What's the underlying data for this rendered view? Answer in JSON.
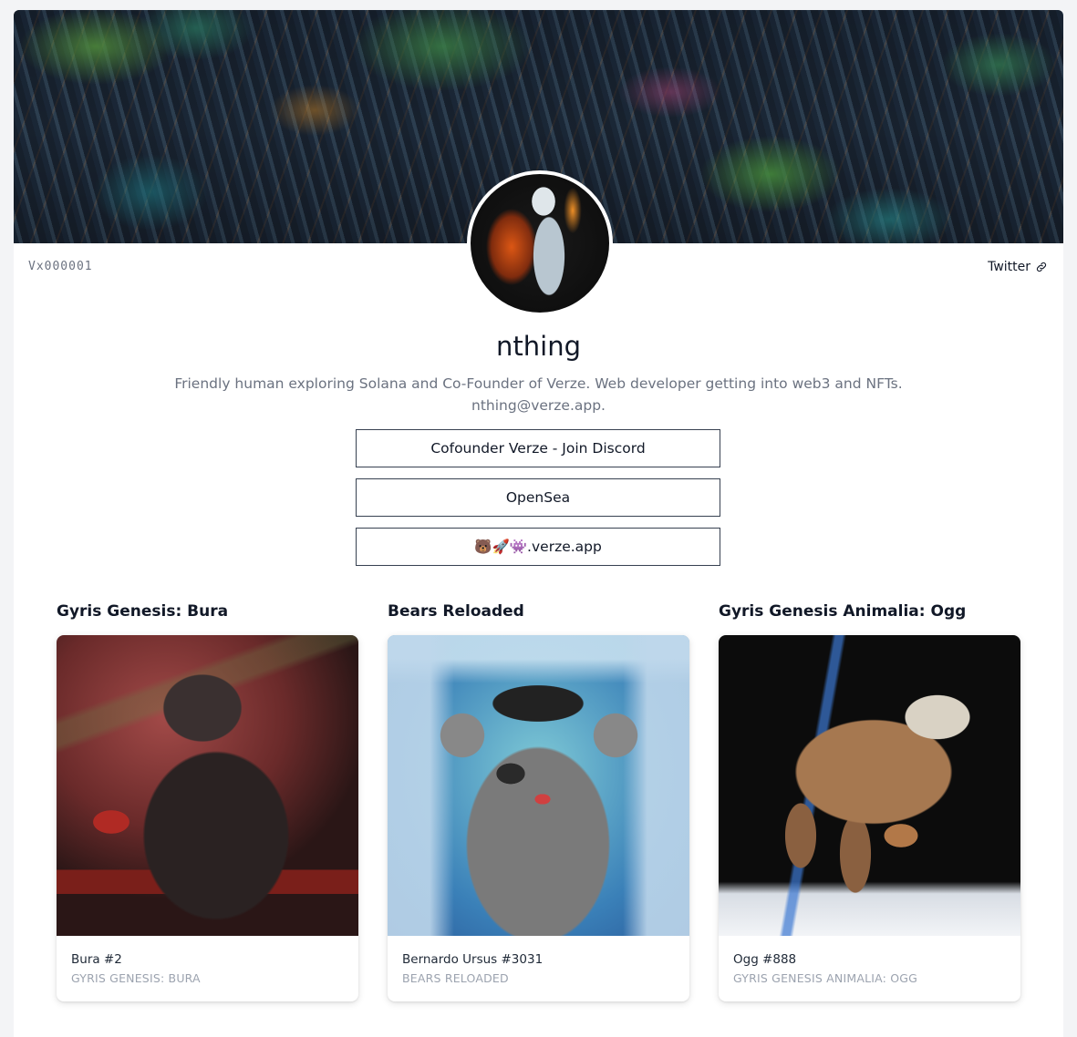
{
  "profile": {
    "serial": "Vx000001",
    "twitter_label": "Twitter",
    "name": "nthing",
    "bio_line1": "Friendly human exploring Solana and Co-Founder of Verze. Web developer getting into web3 and NFTs.",
    "bio_line2": "nthing@verze.app."
  },
  "links": [
    {
      "label": "Cofounder Verze - Join Discord"
    },
    {
      "label": "OpenSea"
    },
    {
      "label": "🐻🚀👾.verze.app"
    }
  ],
  "collections": [
    {
      "heading": "Gyris Genesis: Bura",
      "nft_name": "Bura #2",
      "collection": "Gyris Genesis: Bura"
    },
    {
      "heading": "Bears Reloaded",
      "nft_name": "Bernardo Ursus #3031",
      "collection": "Bears Reloaded"
    },
    {
      "heading": "Gyris Genesis Animalia: Ogg",
      "nft_name": "Ogg #888",
      "collection": "Gyris Genesis Animalia: Ogg"
    }
  ]
}
